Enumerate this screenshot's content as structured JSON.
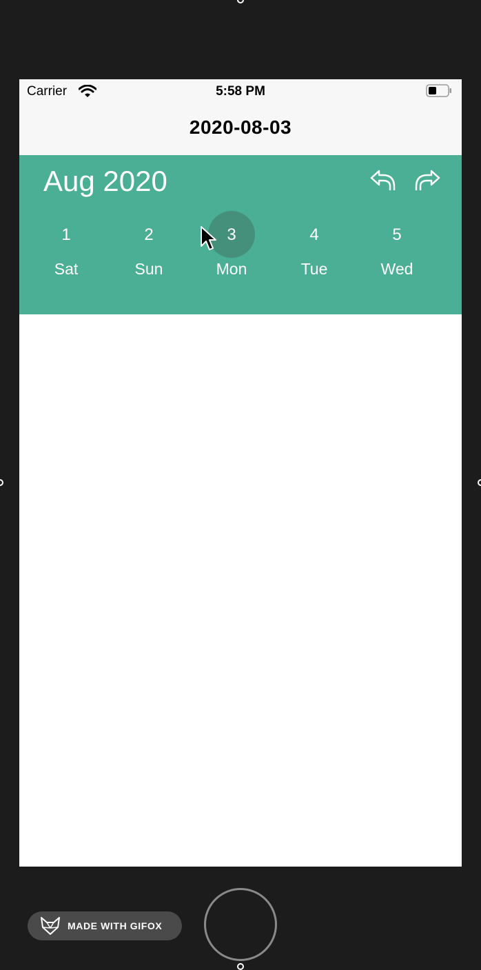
{
  "status_bar": {
    "carrier": "Carrier",
    "time": "5:58 PM",
    "icons": [
      "wifi-icon",
      "battery-icon"
    ]
  },
  "nav_bar": {
    "title": "2020-08-03"
  },
  "calendar": {
    "month_label": "Aug 2020",
    "accent_color": "#4aaf94",
    "selected_color": "#44907a",
    "prev_icon": "reply-arrow-icon",
    "next_icon": "forward-arrow-icon",
    "days": [
      {
        "number": "1",
        "name": "Sat"
      },
      {
        "number": "2",
        "name": "Sun"
      },
      {
        "number": "3",
        "name": "Mon",
        "selected": true
      },
      {
        "number": "4",
        "name": "Tue"
      },
      {
        "number": "5",
        "name": "Wed"
      }
    ]
  },
  "watermark": {
    "label": "MADE WITH GIFOX",
    "icon": "fox-logo-icon"
  }
}
